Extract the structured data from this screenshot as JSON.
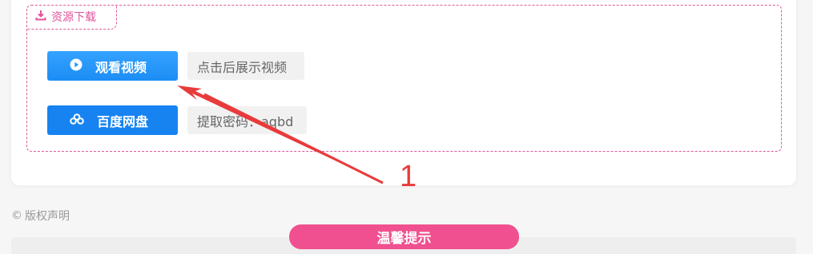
{
  "download": {
    "section_label": "资源下载",
    "video_button_label": "观看视频",
    "video_hint": "点击后展示视频",
    "pan_button_label": "百度网盘",
    "extract_code": "提取密码：aqbd"
  },
  "footer": {
    "copyright_symbol": "©",
    "copyright_label": "版权声明",
    "tip_label": "温馨提示"
  },
  "annotation": {
    "number": "1",
    "color": "#e83b3b"
  },
  "colors": {
    "accent_pink": "#e0559a",
    "button_blue": "#1683f1",
    "tip_pink": "#f0508f"
  },
  "icons": [
    "download-icon",
    "play-icon",
    "baidu-cloud-icon"
  ]
}
